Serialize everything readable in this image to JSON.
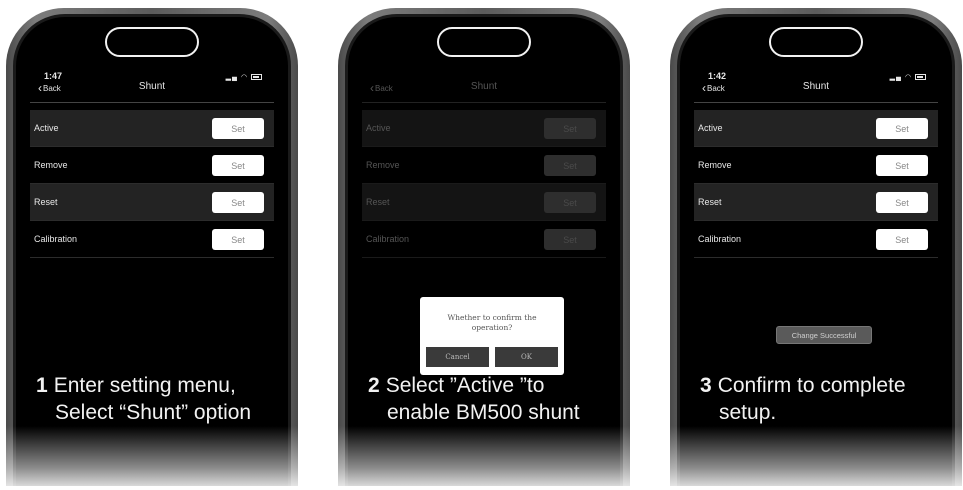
{
  "phones": [
    {
      "status": {
        "time": "1:47",
        "back": "Back",
        "title": "Shunt"
      },
      "rows": [
        {
          "label": "Active",
          "button": "Set"
        },
        {
          "label": "Remove",
          "button": "Set"
        },
        {
          "label": "Reset",
          "button": "Set"
        },
        {
          "label": "Calibration",
          "button": "Set"
        }
      ],
      "caption": {
        "number": "1",
        "line1": "Enter setting menu,",
        "line2": "Select “Shunt” option"
      }
    },
    {
      "status": {
        "time": "",
        "back": "Back",
        "title": "Shunt"
      },
      "rows": [
        {
          "label": "Active",
          "button": "Set"
        },
        {
          "label": "Remove",
          "button": "Set"
        },
        {
          "label": "Reset",
          "button": "Set"
        },
        {
          "label": "Calibration",
          "button": "Set"
        }
      ],
      "dialog": {
        "message": "Whether to confirm the operation?",
        "cancel": "Cancel",
        "ok": "OK"
      },
      "caption": {
        "number": "2",
        "line1": "Select ”Active ”to",
        "line2": "enable BM500 shunt"
      }
    },
    {
      "status": {
        "time": "1:42",
        "back": "Back",
        "title": "Shunt"
      },
      "rows": [
        {
          "label": "Active",
          "button": "Set"
        },
        {
          "label": "Remove",
          "button": "Set"
        },
        {
          "label": "Reset",
          "button": "Set"
        },
        {
          "label": "Calibration",
          "button": "Set"
        }
      ],
      "toast": "Change Successful",
      "caption": {
        "number": "3",
        "line1": "Confirm to complete",
        "line2": "setup."
      }
    }
  ],
  "icons": [
    "signal-icon",
    "wifi-icon",
    "battery-icon",
    "chevron-left-icon"
  ]
}
